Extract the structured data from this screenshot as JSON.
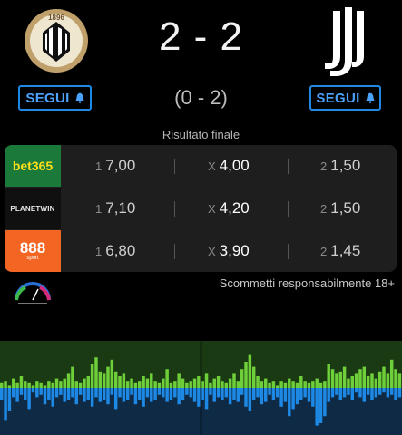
{
  "match": {
    "score": "2 - 2",
    "halftime": "(0 - 2)",
    "status": "Risultato finale",
    "home_crest_text": "1896",
    "follow_home_label": "SEGUI",
    "follow_away_label": "SEGUI"
  },
  "odds": [
    {
      "bookmaker": "bet365",
      "one_key": "1",
      "one": "7,00",
      "x_key": "X",
      "x": "4,00",
      "two_key": "2",
      "two": "1,50"
    },
    {
      "bookmaker": "PLANETWIN",
      "one_key": "1",
      "one": "7,10",
      "x_key": "X",
      "x": "4,20",
      "two_key": "2",
      "two": "1,50"
    },
    {
      "bookmaker": "888",
      "bookmaker_sub": "sport",
      "one_key": "1",
      "one": "6,80",
      "x_key": "X",
      "x": "3,90",
      "two_key": "2",
      "two": "1,45"
    }
  ],
  "responsible_text": "Scommetti responsabilmente 18+",
  "colors": {
    "accent": "#1e88e5",
    "momentum_home": "#6fcf3a",
    "momentum_away": "#1e88e5",
    "momentum_home_bg": "#1a3a14",
    "momentum_away_bg": "#0e2a45"
  },
  "momentum": {
    "home": [
      2,
      3,
      1,
      4,
      2,
      5,
      3,
      2,
      1,
      3,
      2,
      1,
      3,
      2,
      4,
      3,
      4,
      6,
      9,
      3,
      2,
      4,
      5,
      10,
      13,
      7,
      6,
      9,
      12,
      7,
      5,
      6,
      3,
      4,
      2,
      3,
      5,
      4,
      6,
      3,
      2,
      4,
      8,
      2,
      3,
      6,
      4,
      2,
      3,
      4,
      5,
      3,
      6,
      2,
      4,
      5,
      3,
      2,
      4,
      6,
      3,
      8,
      11,
      14,
      9,
      5,
      3,
      4,
      2,
      3,
      1,
      3,
      2,
      4,
      3,
      2,
      5,
      3,
      2,
      3,
      4,
      2,
      3,
      10,
      8,
      6,
      7,
      9,
      4,
      5,
      6,
      8,
      9,
      5,
      6,
      4,
      7,
      9,
      6,
      12,
      8,
      6
    ],
    "away": [
      5,
      14,
      10,
      4,
      6,
      3,
      5,
      9,
      2,
      4,
      3,
      7,
      5,
      8,
      4,
      3,
      6,
      5,
      4,
      7,
      3,
      6,
      5,
      8,
      4,
      6,
      5,
      7,
      3,
      9,
      4,
      6,
      5,
      3,
      7,
      5,
      8,
      4,
      6,
      5,
      3,
      4,
      6,
      5,
      4,
      7,
      5,
      3,
      4,
      6,
      8,
      5,
      9,
      3,
      6,
      4,
      5,
      4,
      7,
      5,
      6,
      3,
      8,
      10,
      5,
      4,
      7,
      6,
      3,
      5,
      4,
      8,
      6,
      12,
      9,
      7,
      5,
      4,
      6,
      8,
      16,
      15,
      12,
      6,
      4,
      3,
      5,
      4,
      3,
      5,
      2,
      4,
      6,
      3,
      5,
      4,
      3,
      2,
      4,
      3,
      5,
      4
    ]
  }
}
